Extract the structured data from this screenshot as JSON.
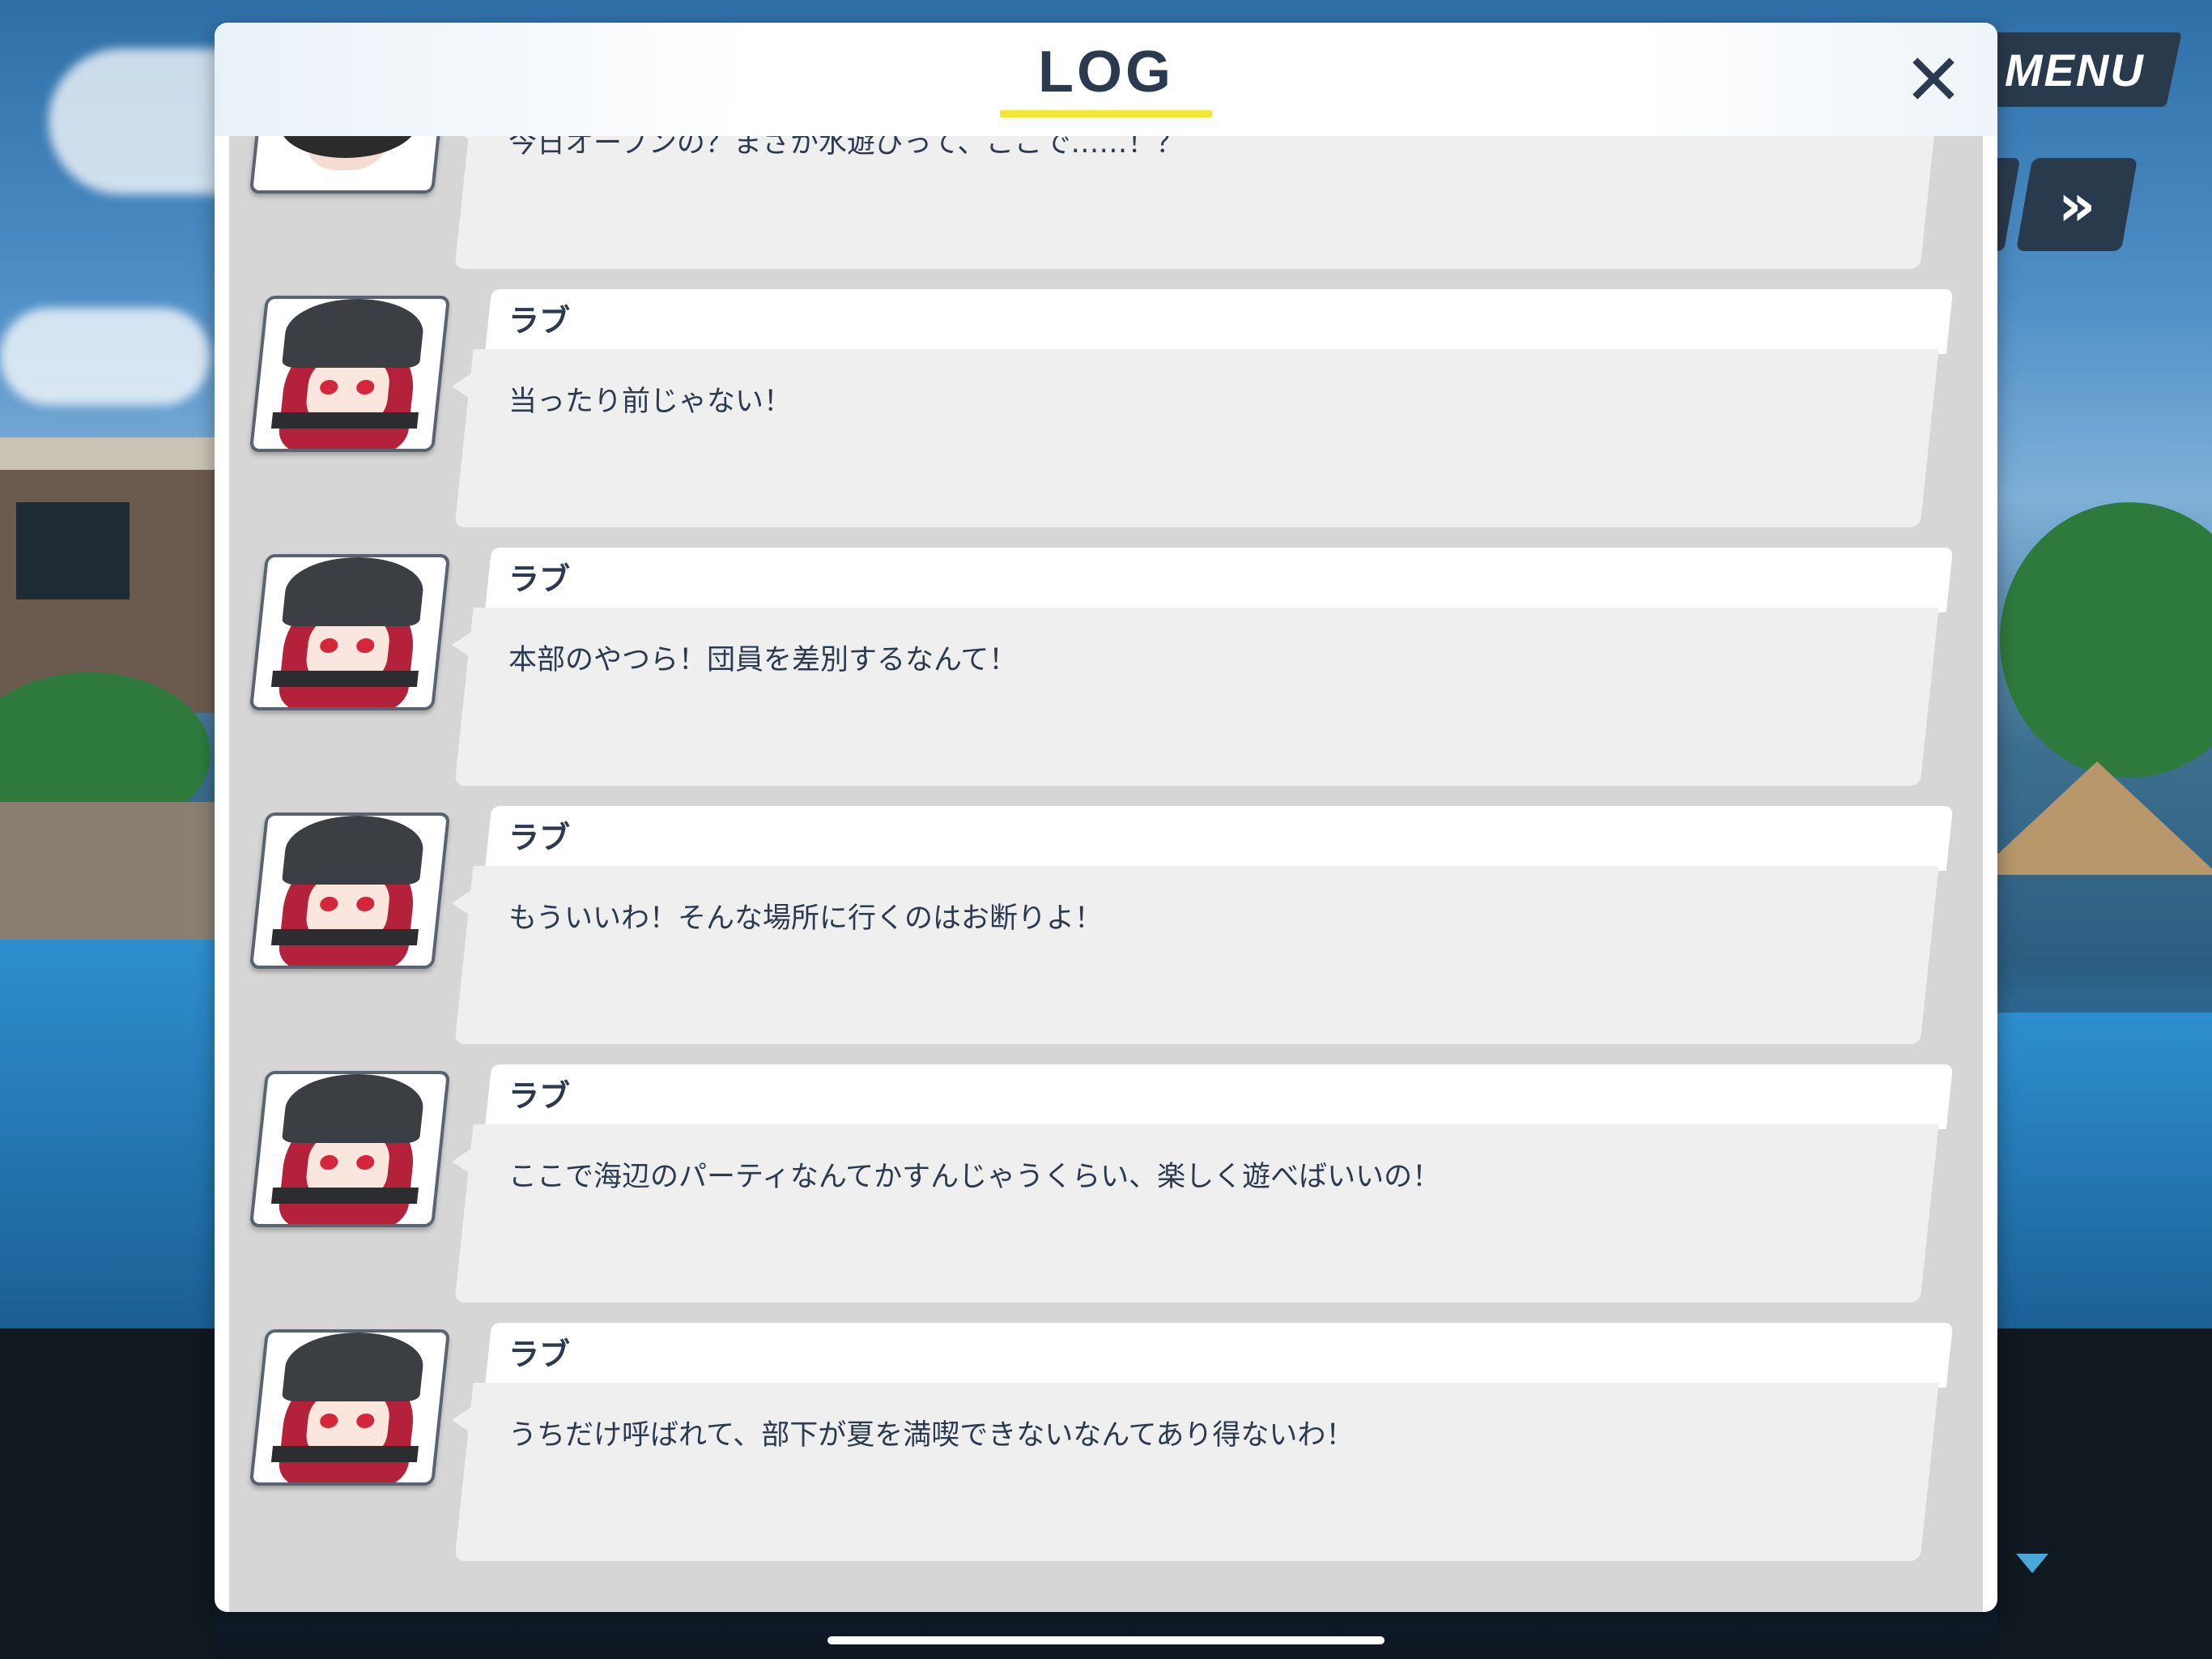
{
  "window": {
    "title": "LOG",
    "close_icon": "close-icon"
  },
  "controls": {
    "menu_label": "MENU",
    "skip_label": "»",
    "scroll_icon": "scroll-down-arrow-icon"
  },
  "colors": {
    "panel_bg": "#ffffff",
    "log_bg": "#d6d6d6",
    "bubble_bg": "#efefef",
    "text": "#2b3a4e",
    "title_underline": "#f5e63a",
    "button_bg": "#2a3a4d"
  },
  "log": {
    "entries": [
      {
        "speaker": "",
        "text": "今日オープンの？まさか水遊びって、ここで……！？",
        "avatar": "masked-character-avatar"
      },
      {
        "speaker": "ラブ",
        "text": "当ったり前じゃない！",
        "avatar": "rabu-avatar"
      },
      {
        "speaker": "ラブ",
        "text": "本部のやつら！団員を差別するなんて！",
        "avatar": "rabu-avatar"
      },
      {
        "speaker": "ラブ",
        "text": "もういいわ！そんな場所に行くのはお断りよ！",
        "avatar": "rabu-avatar"
      },
      {
        "speaker": "ラブ",
        "text": "ここで海辺のパーティなんてかすんじゃうくらい、楽しく遊べばいいの！",
        "avatar": "rabu-avatar"
      },
      {
        "speaker": "ラブ",
        "text": "うちだけ呼ばれて、部下が夏を満喫できないなんてあり得ないわ！",
        "avatar": "rabu-avatar"
      }
    ]
  }
}
